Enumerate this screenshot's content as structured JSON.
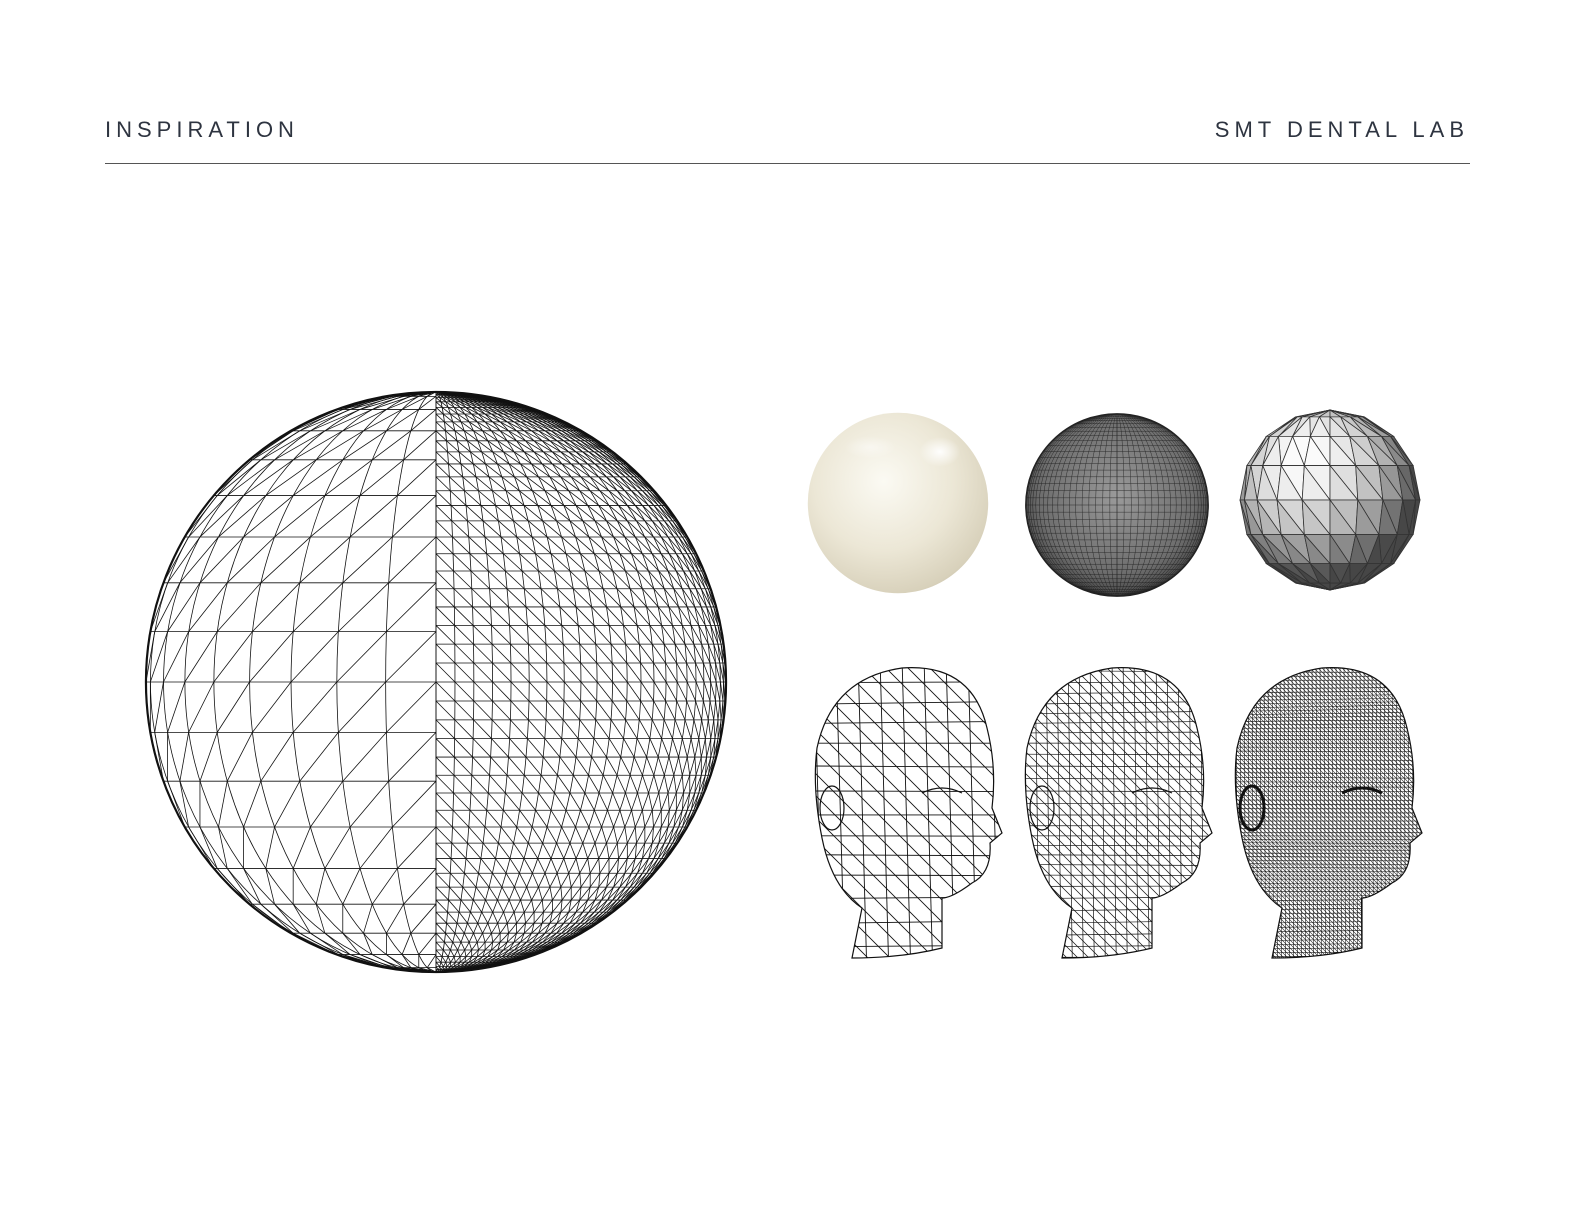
{
  "header": {
    "left_title": "INSPIRATION",
    "right_title": "SMT DENTAL LAB"
  },
  "figures": {
    "large_sphere": "wireframe sphere, coarse mesh left half, fine mesh right half",
    "spheres_row": [
      "glossy ivory sphere",
      "dense gray mesh sphere",
      "faceted low-poly sphere"
    ],
    "heads_row": [
      "low-poly wireframe head",
      "medium-poly wireframe head",
      "high-poly wireframe head"
    ]
  },
  "colors": {
    "text": "#2e3440",
    "rule": "#555555",
    "ivory": "#efebdd",
    "mesh": "#111111"
  }
}
